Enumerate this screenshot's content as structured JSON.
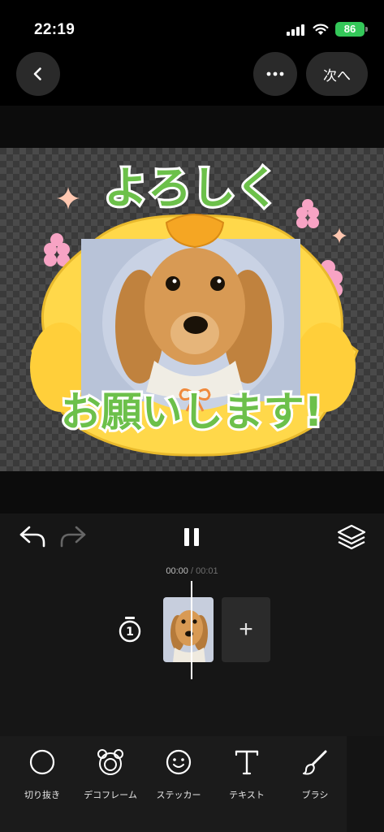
{
  "status_bar": {
    "time": "22:19",
    "battery": "86"
  },
  "nav": {
    "next_label": "次へ"
  },
  "canvas": {
    "sticker_top_text": "よろしく",
    "sticker_bottom_text": "お願いします!"
  },
  "playback": {
    "current": "00:00",
    "separator": " / ",
    "total": "00:01"
  },
  "timeline": {
    "clip_duration_badge": "1"
  },
  "toolbar": {
    "items": [
      {
        "label": "切り抜き",
        "icon": "circle-crop-icon"
      },
      {
        "label": "デコフレーム",
        "icon": "bear-frame-icon"
      },
      {
        "label": "ステッカー",
        "icon": "smiley-icon"
      },
      {
        "label": "テキスト",
        "icon": "text-t-icon"
      },
      {
        "label": "ブラシ",
        "icon": "brush-icon"
      }
    ]
  },
  "colors": {
    "battery": "#34c759",
    "sticker_yellow": "#ffd84a",
    "sticker_green": "#6cc04a",
    "beak": "#f5a623"
  }
}
